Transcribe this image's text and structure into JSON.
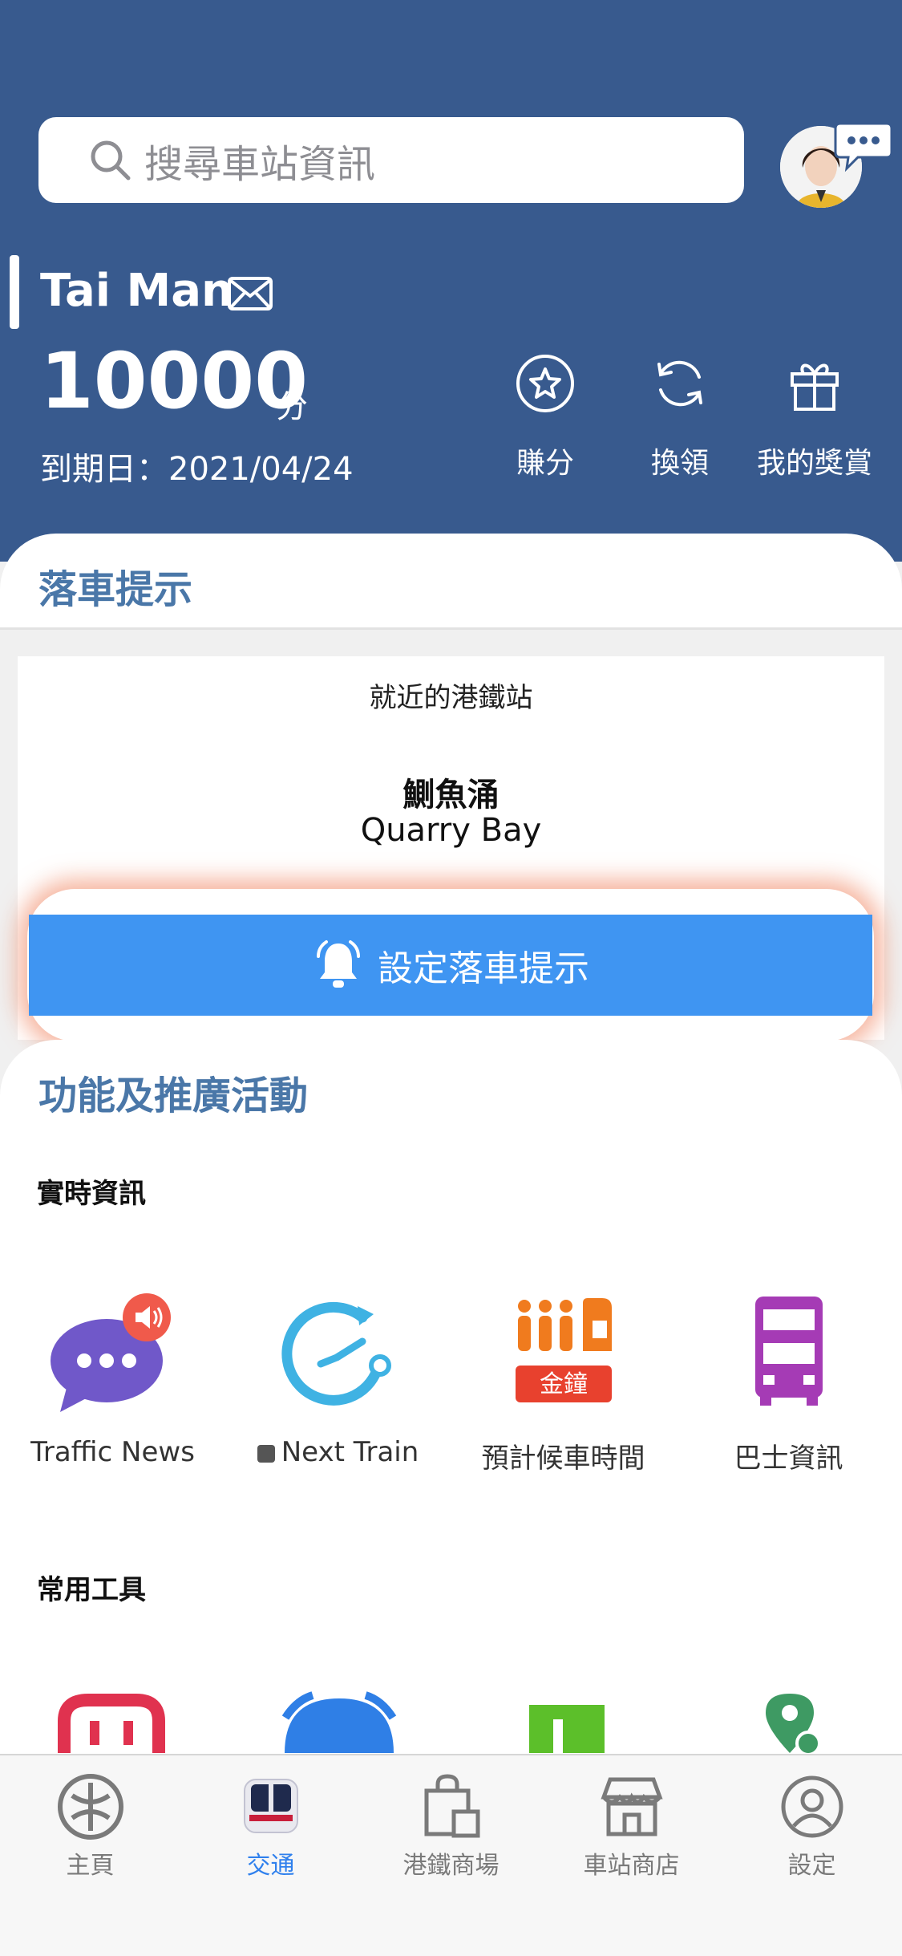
{
  "search": {
    "placeholder": "搜尋車站資訊"
  },
  "member": {
    "name": "Tai Man",
    "points": "10000",
    "points_unit": "分",
    "expiry": "到期日：2021/04/24"
  },
  "actions": [
    {
      "label": "賺分",
      "icon": "star-icon"
    },
    {
      "label": "換領",
      "icon": "refresh-icon"
    },
    {
      "label": "我的獎賞",
      "icon": "gift-icon"
    }
  ],
  "alight": {
    "title": "落車提示",
    "nearby_label": "就近的港鐵站",
    "station_zh": "鰂魚涌",
    "station_en": "Quarry Bay",
    "button_label": "設定落車提示"
  },
  "features": {
    "title": "功能及推廣活動",
    "realtime_heading": "實時資訊",
    "tools_heading": "常用工具",
    "realtime_items": [
      {
        "label": "Traffic News",
        "icon": "chat-bubble-icon"
      },
      {
        "label": "Next Train",
        "icon": "clock-icon"
      },
      {
        "label": "預計候車時間",
        "icon": "queue-icon",
        "badge": "金鐘"
      },
      {
        "label": "巴士資訊",
        "icon": "bus-icon"
      }
    ]
  },
  "tabs": [
    {
      "label": "主頁",
      "icon": "mtr-logo-icon"
    },
    {
      "label": "交通",
      "icon": "train-icon",
      "active": true
    },
    {
      "label": "港鐵商場",
      "icon": "shopping-bag-icon"
    },
    {
      "label": "車站商店",
      "icon": "shop-icon"
    },
    {
      "label": "設定",
      "icon": "user-icon"
    }
  ],
  "colors": {
    "header": "#385a8e",
    "accent_blue": "#3f95f2",
    "section_title": "#4a77a8",
    "tab_active": "#2f80ed"
  }
}
